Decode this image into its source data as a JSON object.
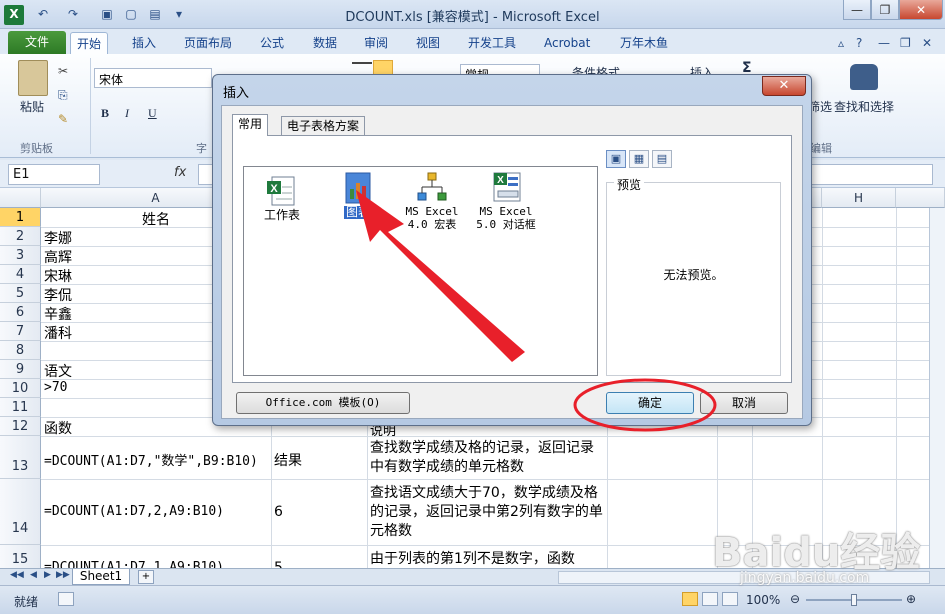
{
  "window": {
    "title": "DCOUNT.xls  [兼容模式] - Microsoft Excel"
  },
  "ribbon_tabs": [
    "文件",
    "开始",
    "插入",
    "页面布局",
    "公式",
    "数据",
    "审阅",
    "视图",
    "开发工具",
    "Acrobat",
    "万年木鱼"
  ],
  "ribbon": {
    "paste_label": "粘贴",
    "clipboard_group": "剪贴板",
    "font_name": "宋体",
    "font_group_partial": "字",
    "bold": "B",
    "italic": "I",
    "underline": "U",
    "number_format": "常规",
    "conditional_format": "条件格式",
    "insert_cells": "插入",
    "sigma": "Σ",
    "find_select": "查找和选择",
    "filter_partial": "筛选",
    "edit_group_partial": "编辑"
  },
  "formula_bar": {
    "name_box": "E1",
    "fx": "fx",
    "value": ""
  },
  "grid": {
    "col_headers": [
      "A",
      "H"
    ],
    "row_headers": [
      "1",
      "2",
      "3",
      "4",
      "5",
      "6",
      "7",
      "8",
      "9",
      "10",
      "11",
      "12",
      "13",
      "14",
      "15"
    ],
    "cells": {
      "a1": "姓名",
      "a2": "李娜",
      "a3": "高辉",
      "a4": "宋琳",
      "a5": "李侃",
      "a6": "辛鑫",
      "a7": "潘科",
      "a9": "语文",
      "a10": ">70",
      "a12": "函数",
      "c12": "说明",
      "a13": "=DCOUNT(A1:D7,\"数学\",B9:B10)",
      "b13": "结果",
      "c13": "查找数学成绩及格的记录，返回记录中有数学成绩的单元格数",
      "a14": "=DCOUNT(A1:D7,2,A9:B10)",
      "b14": "6",
      "c14": "查找语文成绩大于70，数学成绩及格的记录，返回记录中第2列有数字的单元格数",
      "a15": "=DCOUNT(A1:D7,1,A9:B10)",
      "b15": "5",
      "c15": "由于列表的第1列不是数字，函数"
    }
  },
  "sheet_tabs": [
    "Sheet1"
  ],
  "status": {
    "ready": "就绪",
    "zoom": "100%"
  },
  "dialog": {
    "title": "插入",
    "tabs": [
      "常用",
      "电子表格方案"
    ],
    "items": [
      {
        "label": "工作表",
        "icon": "worksheet-icon"
      },
      {
        "label": "图表",
        "icon": "chart-icon"
      },
      {
        "label": "MS Excel 4.0 宏表",
        "icon": "macro-sheet-icon"
      },
      {
        "label": "MS Excel 5.0 对话框",
        "icon": "dialog-sheet-icon"
      }
    ],
    "preview_title": "预览",
    "preview_message": "无法预览。",
    "office_templates_button": "Office.com 模板(O)",
    "ok_button": "确定",
    "cancel_button": "取消"
  },
  "watermark": {
    "brand": "Baidu经验",
    "url": "jingyan.baidu.com"
  },
  "colors": {
    "file_tab": "#2d7a25",
    "annotation_red": "#e8202a",
    "selection_blue": "#3169c6"
  }
}
